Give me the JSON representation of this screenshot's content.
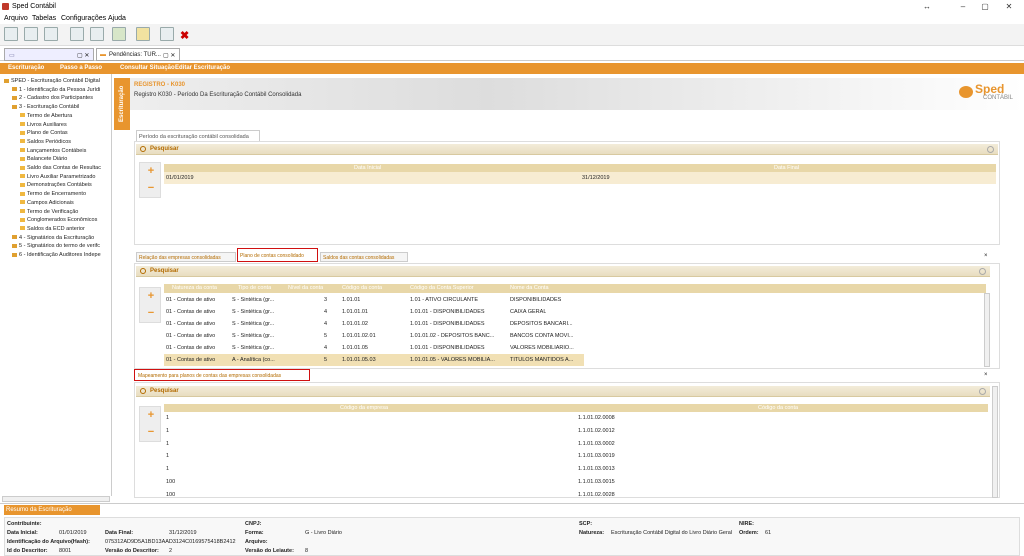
{
  "app": {
    "title": "Sped Contábil"
  },
  "menu": [
    "Arquivo",
    "Tabelas",
    "Configurações",
    "Ajuda"
  ],
  "tabs": {
    "left": "Escrituração",
    "right": "Pendências: TUR..."
  },
  "nav": {
    "items": [
      "Escrituração",
      "Passo a Passo",
      "Consultar Situação",
      "Editar Escrituração"
    ]
  },
  "tree": [
    {
      "label": "SPED - Escrituração Contábil Digital",
      "level": 0
    },
    {
      "label": "1 - Identificação da Pessoa Jurídi",
      "level": 1
    },
    {
      "label": "2 - Cadastro dos Participantes",
      "level": 1
    },
    {
      "label": "3 - Escrituração Contábil",
      "level": 1
    },
    {
      "label": "Termo de Abertura",
      "level": 2
    },
    {
      "label": "Livros Auxiliares",
      "level": 2
    },
    {
      "label": "Plano de Contas",
      "level": 2
    },
    {
      "label": "Saldos Periódicos",
      "level": 2
    },
    {
      "label": "Lançamentos Contábeis",
      "level": 2
    },
    {
      "label": "Balancete Diário",
      "level": 2
    },
    {
      "label": "Saldo das Contas de Resultac",
      "level": 2
    },
    {
      "label": "Livro Auxiliar Parametrizado",
      "level": 2
    },
    {
      "label": "Demonstrações Contábeis",
      "level": 2
    },
    {
      "label": "Termo de Encerramento",
      "level": 2
    },
    {
      "label": "Campos Adicionais",
      "level": 2
    },
    {
      "label": "Termo de Verificação",
      "level": 2
    },
    {
      "label": "Conglomerados Econômicos",
      "level": 2
    },
    {
      "label": "Saldos da ECD anterior",
      "level": 2
    },
    {
      "label": "4 - Signatários da Escrituração",
      "level": 1
    },
    {
      "label": "5 - Signatários do termo de verifc",
      "level": 1
    },
    {
      "label": "6 - Identificação Auditores Indepe",
      "level": 1
    }
  ],
  "vtab": "Escrituração",
  "banner": {
    "register": "REGISTRO - K030",
    "description": "Registro K030 - Período Da Escrituração Contábil Consolidada",
    "logo": "Sped",
    "logo_sub": "CONTÁBIL"
  },
  "period": {
    "tab": "Período da escrituração contábil consolidada",
    "search": "Pesquisar",
    "headers": [
      "Data Inicial",
      "Data Final"
    ],
    "row": [
      "01/01/2019",
      "31/12/2019"
    ]
  },
  "subtabs": [
    "Relação das empresas consolidadas",
    "Plano de contas consolidado",
    "Saldos das contas consolidadas"
  ],
  "plano": {
    "search": "Pesquisar",
    "headers": [
      "Natureza da conta",
      "Tipo de conta",
      "Nível da conta",
      "Código da conta",
      "Código da Conta Superior",
      "Nome da Conta"
    ],
    "rows": [
      [
        "01 - Contas de ativo",
        "S - Sintética (gr...",
        "3",
        "1.01.01",
        "1.01 - ATIVO CIRCULANTE",
        "DISPONIBILIDADES"
      ],
      [
        "01 - Contas de ativo",
        "S - Sintética (gr...",
        "4",
        "1.01.01.01",
        "1.01.01 - DISPONIBILIDADES",
        "CAIXA GERAL"
      ],
      [
        "01 - Contas de ativo",
        "S - Sintética (gr...",
        "4",
        "1.01.01.02",
        "1.01.01 - DISPONIBILIDADES",
        "DEPÓSITOS BANCÁRI..."
      ],
      [
        "01 - Contas de ativo",
        "S - Sintética (gr...",
        "5",
        "1.01.01.02.01",
        "1.01.01.02 - DEPÓSITOS BANC...",
        "BANCOS CONTA MOVI..."
      ],
      [
        "01 - Contas de ativo",
        "S - Sintética (gr...",
        "4",
        "1.01.01.05",
        "1.01.01 - DISPONIBILIDADES",
        "VALORES MOBILIÁRIO..."
      ],
      [
        "01 - Contas de ativo",
        "A - Analítica (co...",
        "5",
        "1.01.01.05.03",
        "1.01.01.05 - VALORES MOBILIÁ...",
        "TÍTULOS MANTIDOS A..."
      ]
    ]
  },
  "mapeamento": {
    "tab": "Mapeamento para planos de contas das empresas consolidadas",
    "search": "Pesquisar",
    "headers": [
      "Código da empresa",
      "Código da conta"
    ],
    "rows": [
      [
        "1",
        "1.1.01.02.0008"
      ],
      [
        "1",
        "1.1.01.02.0012"
      ],
      [
        "1",
        "1.1.01.03.0002"
      ],
      [
        "1",
        "1.1.01.03.0019"
      ],
      [
        "1",
        "1.1.01.03.0013"
      ],
      [
        "100",
        "1.1.01.03.0015"
      ],
      [
        "100",
        "1.1.01.02.0028"
      ]
    ]
  },
  "resumo": {
    "title": "Resumo da Escrituração",
    "contribuinte": "Contribuinte:",
    "data_inicial_l": "Data Inicial:",
    "data_inicial": "01/01/2019",
    "data_final_l": "Data Final:",
    "data_final": "31/12/2019",
    "ident_l": "Identificação do Arquivo(Hash):",
    "ident": "075312AD9D5A1BD13AAD3124C0169575418B2412",
    "id_desc_l": "Id do Descritor:",
    "id_desc": "8001",
    "versao_desc_l": "Versão do Descritor:",
    "versao_desc": "2",
    "cnpj_l": "CNPJ:",
    "forma_l": "Forma:",
    "forma": "G - Livro Diário",
    "arquivo_l": "Arquivo:",
    "versao_leiaute_l": "Versão do Leiaute:",
    "versao_leiaute": "8",
    "scp_l": "SCP:",
    "natureza_l": "Natureza:",
    "natureza": "Escrituração Contábil Digital do Livro Diário Geral",
    "nire_l": "NIRE:",
    "ordem_l": "Ordem:",
    "ordem": "61"
  }
}
